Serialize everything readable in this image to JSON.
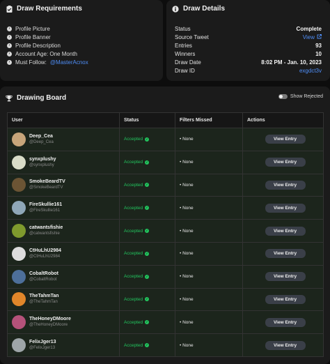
{
  "requirements": {
    "title": "Draw Requirements",
    "items": [
      {
        "label": "Profile Picture"
      },
      {
        "label": "Profile Banner"
      },
      {
        "label": "Profile Description"
      },
      {
        "label": "Account Age: One Month"
      },
      {
        "label": "Must Follow: ",
        "mention": "@MasterAcnox"
      }
    ]
  },
  "details": {
    "title": "Draw Details",
    "rows": [
      {
        "key": "Status",
        "value": "Complete",
        "style": "plain"
      },
      {
        "key": "Source Tweet",
        "value": "View",
        "style": "link"
      },
      {
        "key": "Entries",
        "value": "93",
        "style": "plain"
      },
      {
        "key": "Winners",
        "value": "10",
        "style": "plain"
      },
      {
        "key": "Draw Date",
        "value": "8:02 PM - Jan. 10, 2023",
        "style": "plain"
      },
      {
        "key": "Draw ID",
        "value": "exgdct3v",
        "style": "id"
      }
    ]
  },
  "board": {
    "title": "Drawing Board",
    "toggle_label": "Show Rejected",
    "toggle_on": false,
    "columns": [
      "User",
      "Status",
      "Filters Missed",
      "Actions"
    ],
    "rows": [
      {
        "name": "Deep_Cea",
        "handle": "@Deep_Cea",
        "status": "Accepted",
        "filters": "• None",
        "action": "View Entry",
        "avatar_color": "#c7a57a"
      },
      {
        "name": "synxplushy",
        "handle": "@synxplushy",
        "status": "Accepted",
        "filters": "• None",
        "action": "View Entry",
        "avatar_color": "#d9dcc8"
      },
      {
        "name": "SmokeBeardTV",
        "handle": "@SmokeBeardTV",
        "status": "Accepted",
        "filters": "• None",
        "action": "View Entry",
        "avatar_color": "#6b5434"
      },
      {
        "name": "FireSkullie161",
        "handle": "@FireSkullie161",
        "status": "Accepted",
        "filters": "• None",
        "action": "View Entry",
        "avatar_color": "#8fa7b8"
      },
      {
        "name": "catwantsfishie",
        "handle": "@catwantsfishie",
        "status": "Accepted",
        "filters": "• None",
        "action": "View Entry",
        "avatar_color": "#7f9a2d"
      },
      {
        "name": "CtHuLhU2984",
        "handle": "@CtHuLhU2984",
        "status": "Accepted",
        "filters": "• None",
        "action": "View Entry",
        "avatar_color": "#dcdcdc"
      },
      {
        "name": "CobaltRobot",
        "handle": "@CobaltRobot",
        "status": "Accepted",
        "filters": "• None",
        "action": "View Entry",
        "avatar_color": "#4d6f9a"
      },
      {
        "name": "TheTahmTan",
        "handle": "@TheTahmTan",
        "status": "Accepted",
        "filters": "• None",
        "action": "View Entry",
        "avatar_color": "#e0862a"
      },
      {
        "name": "TheHoneyDMoore",
        "handle": "@TheHoneyDMoore",
        "status": "Accepted",
        "filters": "• None",
        "action": "View Entry",
        "avatar_color": "#b5527a"
      },
      {
        "name": "FelixJger13",
        "handle": "@FelixJger13",
        "status": "Accepted",
        "filters": "• None",
        "action": "View Entry",
        "avatar_color": "#9ea5a8"
      }
    ]
  },
  "icons": {
    "requirements": "clipboard-check-icon",
    "details": "info-icon",
    "board": "trophy-icon",
    "row_bullet": "chevron-right-icon",
    "status": "check-circle-icon",
    "source_link": "external-link-icon"
  },
  "colors": {
    "accent": "#4f8ef7",
    "accepted": "#22c55e",
    "card": "#1b1b1b",
    "background": "#0d0d0d"
  }
}
